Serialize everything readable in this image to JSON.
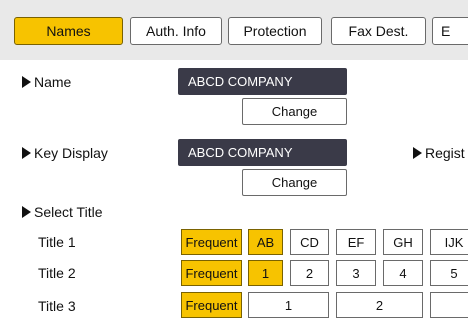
{
  "tabs": [
    "Names",
    "Auth. Info",
    "Protection",
    "Fax Dest.",
    "E"
  ],
  "name": {
    "label": "Name",
    "value": "ABCD COMPANY",
    "change_label": "Change"
  },
  "key_display": {
    "label": "Key Display",
    "value": "ABCD COMPANY",
    "change_label": "Change"
  },
  "registration_label": "Regist",
  "select_title": {
    "label": "Select Title",
    "rows": [
      {
        "label": "Title 1",
        "options": [
          "Frequent",
          "AB",
          "CD",
          "EF",
          "GH",
          "IJK"
        ],
        "selected": [
          0,
          1
        ]
      },
      {
        "label": "Title 2",
        "options": [
          "Frequent",
          "1",
          "2",
          "3",
          "4",
          "5"
        ],
        "selected": [
          0,
          1
        ]
      },
      {
        "label": "Title 3",
        "options": [
          "Frequent",
          "1",
          "2",
          ""
        ],
        "selected": [
          0
        ]
      }
    ]
  },
  "colors": {
    "accent": "#f7c300",
    "field_bg": "#3a3a48",
    "band_bg": "#e9e9e9"
  }
}
